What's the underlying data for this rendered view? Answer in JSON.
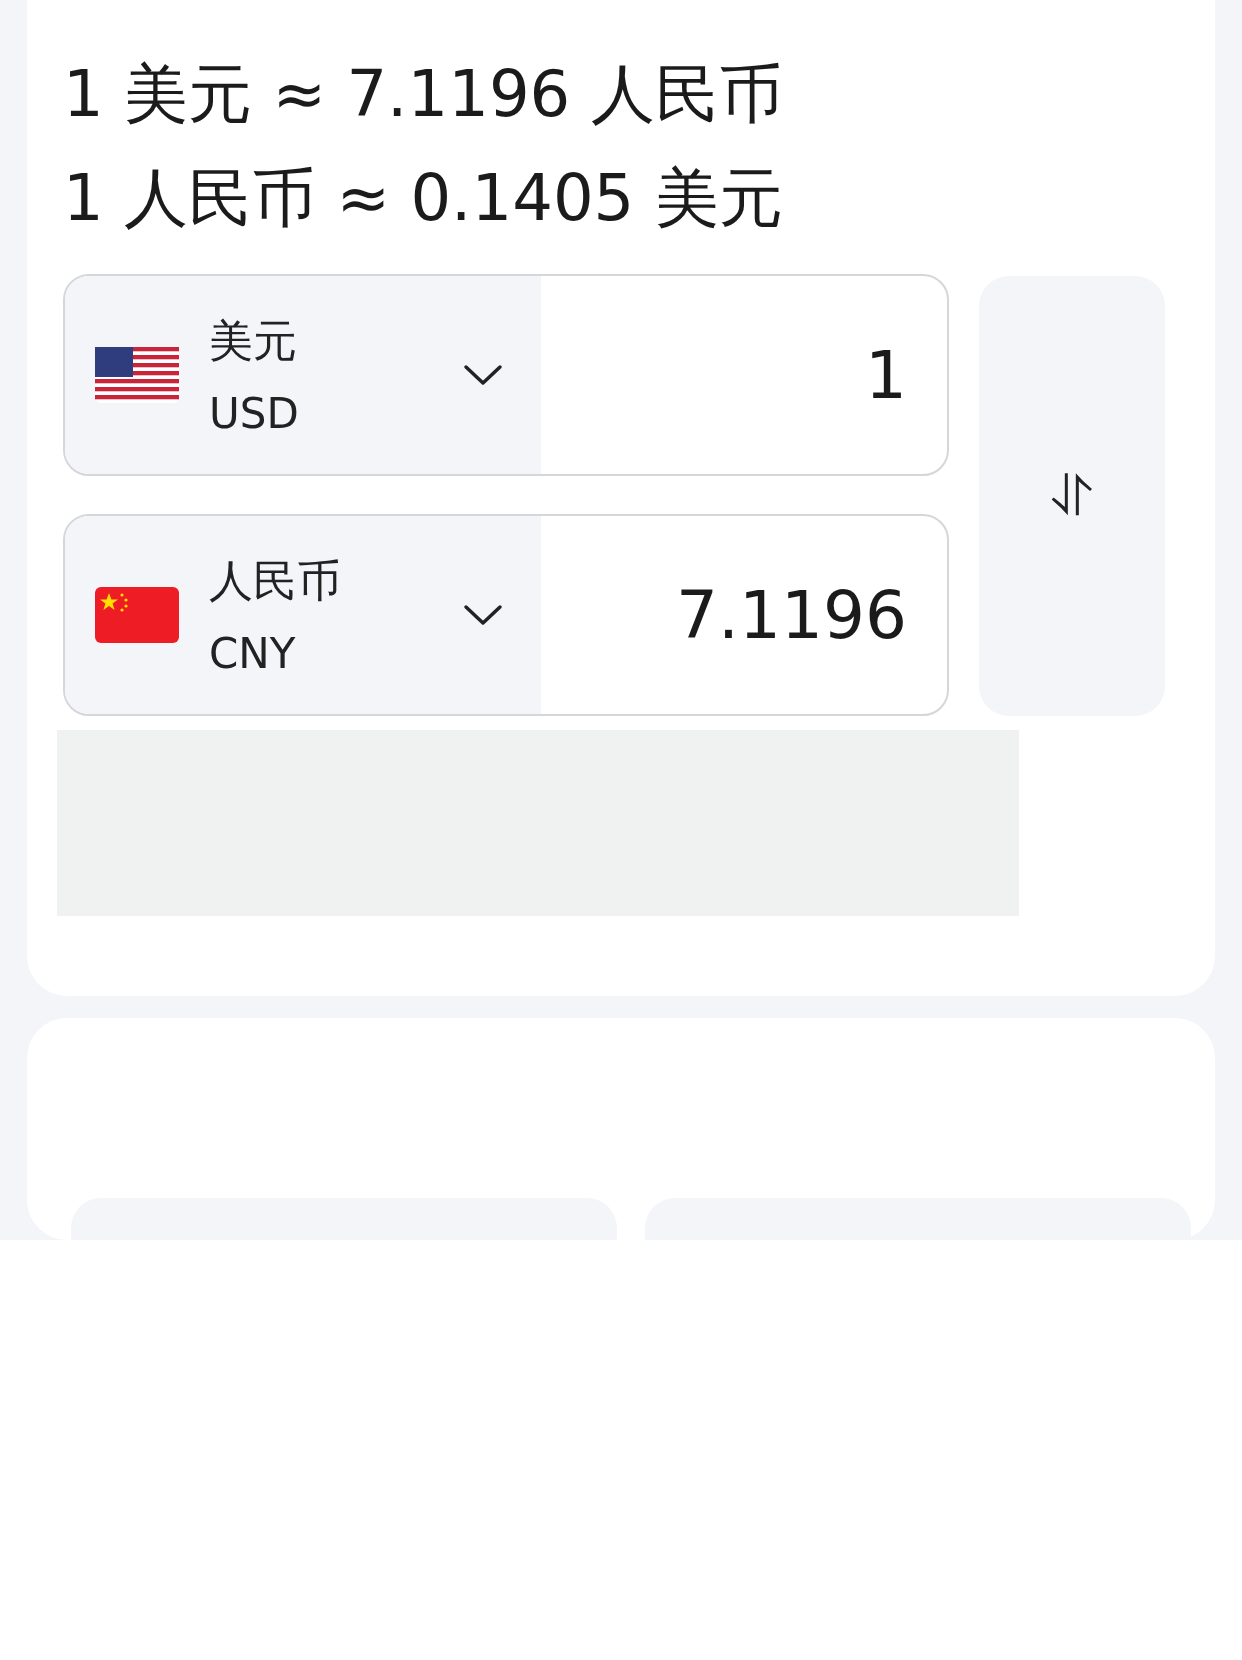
{
  "rates": [
    "1 美元 ≈ 7.1196 人民币",
    "1 人民币 ≈ 0.1405 美元"
  ],
  "converter": [
    {
      "kind": "us",
      "name": "美元",
      "code": "USD",
      "amount": "1"
    },
    {
      "kind": "cn",
      "name": "人民币",
      "code": "CNY",
      "amount": "7.1196"
    }
  ],
  "swap_button": {
    "icon": "⥯"
  }
}
